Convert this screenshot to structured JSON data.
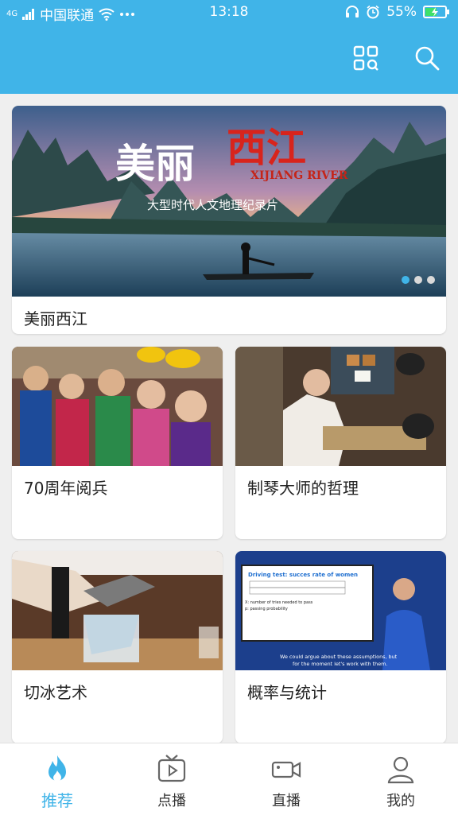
{
  "status_bar": {
    "carrier": "中国联通",
    "time": "13:18",
    "battery": "55%",
    "network_badge": "4G"
  },
  "header": {
    "grid_icon": "grid-icon",
    "search_icon": "search-icon"
  },
  "banner": {
    "title": "美丽西江",
    "image_title": "美丽西江",
    "image_subtitle_en": "XIJIANG RIVER",
    "image_caption": "大型时代人文地理纪录片",
    "pager_total": 3,
    "pager_active": 1
  },
  "videos": [
    {
      "title": "70周年阅兵"
    },
    {
      "title": "制琴大师的哲理"
    },
    {
      "title": "切冰艺术"
    },
    {
      "title": "概率与统计"
    }
  ],
  "slide": {
    "heading": "Driving test: succes rate of women",
    "line1": "X: number of tries needed to pass",
    "line2": "p: passing probability",
    "subtitle1": "We could argue about these assumptions, but",
    "subtitle2": "for the moment let's work with them."
  },
  "tabs": [
    {
      "label": "推荐",
      "icon": "flame-icon",
      "active": true
    },
    {
      "label": "点播",
      "icon": "tv-play-icon",
      "active": false
    },
    {
      "label": "直播",
      "icon": "video-camera-icon",
      "active": false
    },
    {
      "label": "我的",
      "icon": "user-icon",
      "active": false
    }
  ],
  "colors": {
    "accent": "#40b4e8",
    "background": "#efefef",
    "card": "#ffffff"
  }
}
